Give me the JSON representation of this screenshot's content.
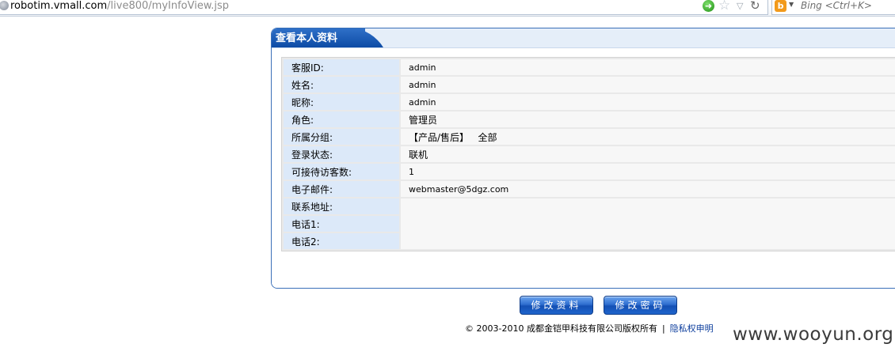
{
  "browser": {
    "url_host": "robotim.vmall.com",
    "url_path": "/live800/myInfoView.jsp",
    "search_placeholder": "Bing <Ctrl+K>",
    "go_glyph": "➜",
    "star_glyph": "☆",
    "menu_glyph": "▽",
    "reload_glyph": "↻",
    "bing_glyph": "b"
  },
  "panel": {
    "title": "查看本人资料",
    "rows": [
      {
        "label": "客服ID:",
        "value": "admin"
      },
      {
        "label": "姓名:",
        "value": "admin"
      },
      {
        "label": "昵称:",
        "value": "admin"
      },
      {
        "label": "角色:",
        "value": "管理员"
      },
      {
        "label": "所属分组:",
        "value": "【产品/售后】   全部"
      },
      {
        "label": "登录状态:",
        "value": "联机"
      },
      {
        "label": "可接待访客数:",
        "value": "1"
      },
      {
        "label": "电子邮件:",
        "value": "webmaster@5dgz.com"
      },
      {
        "label": "联系地址:",
        "value": ""
      },
      {
        "label": "电话1:",
        "value": ""
      },
      {
        "label": "电话2:",
        "value": ""
      }
    ]
  },
  "buttons": {
    "edit_info": "修改资料",
    "change_password": "修改密码"
  },
  "footer": {
    "copyright": "© 2003-2010 成都金铠甲科技有限公司版权所有",
    "separator": "|",
    "privacy_link": "隐私权申明"
  },
  "watermark": "www.wooyun.org",
  "colors": {
    "accent": "#1450b4",
    "label_bg": "#dce9f9",
    "value_bg": "#f7f7f7",
    "link": "#0b3c9c"
  }
}
